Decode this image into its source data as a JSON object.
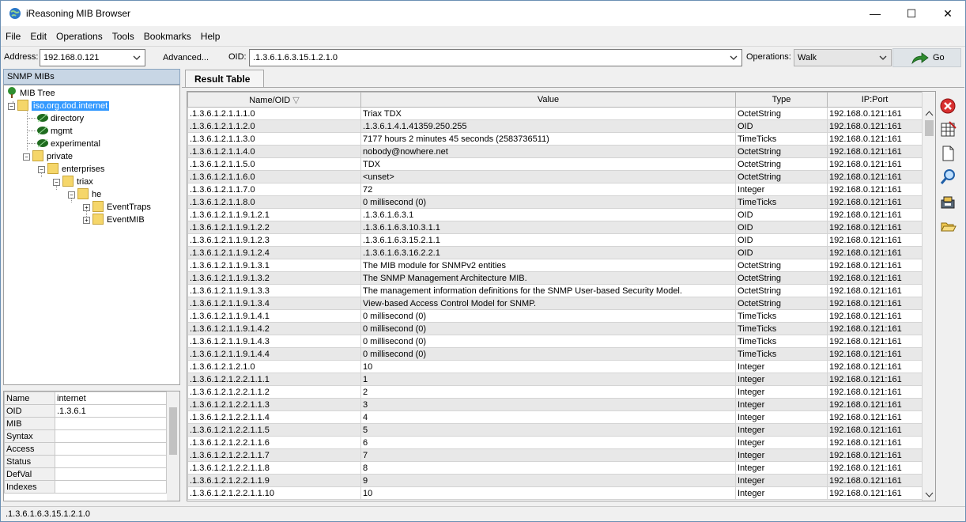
{
  "window": {
    "title": "iReasoning MIB Browser"
  },
  "menu": [
    "File",
    "Edit",
    "Operations",
    "Tools",
    "Bookmarks",
    "Help"
  ],
  "toolbar": {
    "address_label": "Address:",
    "address_value": "192.168.0.121",
    "advanced_label": "Advanced...",
    "oid_label": "OID:",
    "oid_value": ".1.3.6.1.6.3.15.1.2.1.0",
    "operations_label": "Operations:",
    "operations_value": "Walk",
    "go_label": "Go"
  },
  "left_panel": {
    "header": "SNMP MIBs",
    "tree": {
      "root": "MIB Tree",
      "internet": "iso.org.dod.internet",
      "directory": "directory",
      "mgmt": "mgmt",
      "experimental": "experimental",
      "private": "private",
      "enterprises": "enterprises",
      "triax": "triax",
      "he": "he",
      "eventtraps": "EventTraps",
      "eventmib": "EventMIB"
    },
    "properties": [
      {
        "key": "Name",
        "value": "internet"
      },
      {
        "key": "OID",
        "value": ".1.3.6.1"
      },
      {
        "key": "MIB",
        "value": ""
      },
      {
        "key": "Syntax",
        "value": ""
      },
      {
        "key": "Access",
        "value": ""
      },
      {
        "key": "Status",
        "value": ""
      },
      {
        "key": "DefVal",
        "value": ""
      },
      {
        "key": "Indexes",
        "value": ""
      }
    ]
  },
  "tab": {
    "label": "Result Table"
  },
  "table": {
    "columns": [
      "Name/OID",
      "Value",
      "Type",
      "IP:Port"
    ],
    "sort_indicator": "▽",
    "rows": [
      [
        ".1.3.6.1.2.1.1.1.0",
        "Triax TDX",
        "OctetString",
        "192.168.0.121:161"
      ],
      [
        ".1.3.6.1.2.1.1.2.0",
        ".1.3.6.1.4.1.41359.250.255",
        "OID",
        "192.168.0.121:161"
      ],
      [
        ".1.3.6.1.2.1.1.3.0",
        "7177 hours 2 minutes 45 seconds (2583736511)",
        "TimeTicks",
        "192.168.0.121:161"
      ],
      [
        ".1.3.6.1.2.1.1.4.0",
        "nobody@nowhere.net",
        "OctetString",
        "192.168.0.121:161"
      ],
      [
        ".1.3.6.1.2.1.1.5.0",
        "TDX",
        "OctetString",
        "192.168.0.121:161"
      ],
      [
        ".1.3.6.1.2.1.1.6.0",
        "<unset>",
        "OctetString",
        "192.168.0.121:161"
      ],
      [
        ".1.3.6.1.2.1.1.7.0",
        "72",
        "Integer",
        "192.168.0.121:161"
      ],
      [
        ".1.3.6.1.2.1.1.8.0",
        "0 millisecond (0)",
        "TimeTicks",
        "192.168.0.121:161"
      ],
      [
        ".1.3.6.1.2.1.1.9.1.2.1",
        ".1.3.6.1.6.3.1",
        "OID",
        "192.168.0.121:161"
      ],
      [
        ".1.3.6.1.2.1.1.9.1.2.2",
        ".1.3.6.1.6.3.10.3.1.1",
        "OID",
        "192.168.0.121:161"
      ],
      [
        ".1.3.6.1.2.1.1.9.1.2.3",
        ".1.3.6.1.6.3.15.2.1.1",
        "OID",
        "192.168.0.121:161"
      ],
      [
        ".1.3.6.1.2.1.1.9.1.2.4",
        ".1.3.6.1.6.3.16.2.2.1",
        "OID",
        "192.168.0.121:161"
      ],
      [
        ".1.3.6.1.2.1.1.9.1.3.1",
        "The MIB module for SNMPv2 entities",
        "OctetString",
        "192.168.0.121:161"
      ],
      [
        ".1.3.6.1.2.1.1.9.1.3.2",
        "The SNMP Management Architecture MIB.",
        "OctetString",
        "192.168.0.121:161"
      ],
      [
        ".1.3.6.1.2.1.1.9.1.3.3",
        "The management information definitions for the SNMP User-based Security Model.",
        "OctetString",
        "192.168.0.121:161"
      ],
      [
        ".1.3.6.1.2.1.1.9.1.3.4",
        "View-based Access Control Model for SNMP.",
        "OctetString",
        "192.168.0.121:161"
      ],
      [
        ".1.3.6.1.2.1.1.9.1.4.1",
        "0 millisecond (0)",
        "TimeTicks",
        "192.168.0.121:161"
      ],
      [
        ".1.3.6.1.2.1.1.9.1.4.2",
        "0 millisecond (0)",
        "TimeTicks",
        "192.168.0.121:161"
      ],
      [
        ".1.3.6.1.2.1.1.9.1.4.3",
        "0 millisecond (0)",
        "TimeTicks",
        "192.168.0.121:161"
      ],
      [
        ".1.3.6.1.2.1.1.9.1.4.4",
        "0 millisecond (0)",
        "TimeTicks",
        "192.168.0.121:161"
      ],
      [
        ".1.3.6.1.2.1.2.1.0",
        "10",
        "Integer",
        "192.168.0.121:161"
      ],
      [
        ".1.3.6.1.2.1.2.2.1.1.1",
        "1",
        "Integer",
        "192.168.0.121:161"
      ],
      [
        ".1.3.6.1.2.1.2.2.1.1.2",
        "2",
        "Integer",
        "192.168.0.121:161"
      ],
      [
        ".1.3.6.1.2.1.2.2.1.1.3",
        "3",
        "Integer",
        "192.168.0.121:161"
      ],
      [
        ".1.3.6.1.2.1.2.2.1.1.4",
        "4",
        "Integer",
        "192.168.0.121:161"
      ],
      [
        ".1.3.6.1.2.1.2.2.1.1.5",
        "5",
        "Integer",
        "192.168.0.121:161"
      ],
      [
        ".1.3.6.1.2.1.2.2.1.1.6",
        "6",
        "Integer",
        "192.168.0.121:161"
      ],
      [
        ".1.3.6.1.2.1.2.2.1.1.7",
        "7",
        "Integer",
        "192.168.0.121:161"
      ],
      [
        ".1.3.6.1.2.1.2.2.1.1.8",
        "8",
        "Integer",
        "192.168.0.121:161"
      ],
      [
        ".1.3.6.1.2.1.2.2.1.1.9",
        "9",
        "Integer",
        "192.168.0.121:161"
      ],
      [
        ".1.3.6.1.2.1.2.2.1.1.10",
        "10",
        "Integer",
        "192.168.0.121:161"
      ]
    ]
  },
  "side_tools": [
    "stop-icon",
    "table-icon",
    "document-icon",
    "find-icon",
    "export-icon",
    "open-folder-icon"
  ],
  "status": ".1.3.6.1.6.3.15.1.2.1.0",
  "colors": {
    "selection": "#3399ff",
    "header_panel": "#c8d6e5",
    "row_alt": "#e8e8e8",
    "go_arrow": "#2e8b2e",
    "stop_red": "#d83030"
  }
}
